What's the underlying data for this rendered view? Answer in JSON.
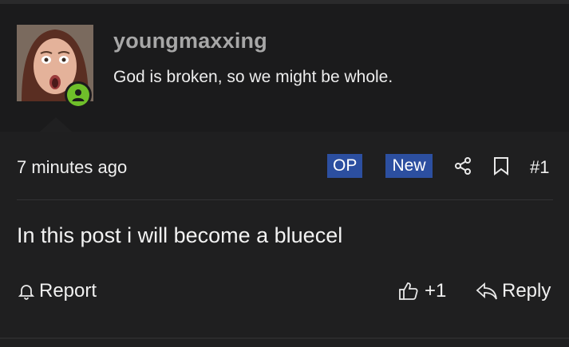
{
  "author": {
    "username": "youngmaxxing",
    "signature": "God is broken, so we might be whole.",
    "avatar_icon": "user-avatar",
    "online_status": "online",
    "online_color": "#6fbf2a"
  },
  "meta": {
    "timestamp": "7 minutes ago",
    "badges": [
      "OP",
      "New"
    ],
    "badge_color": "#2c4fa0",
    "share_icon": "share-icon",
    "bookmark_icon": "bookmark-icon",
    "post_number": "#1"
  },
  "body": {
    "text": "In this post i will become a bluecel"
  },
  "actions": {
    "report_label": "Report",
    "report_icon": "bell-icon",
    "like_count": "+1",
    "like_icon": "thumbs-up-icon",
    "reply_label": "Reply",
    "reply_icon": "reply-arrow-icon"
  }
}
